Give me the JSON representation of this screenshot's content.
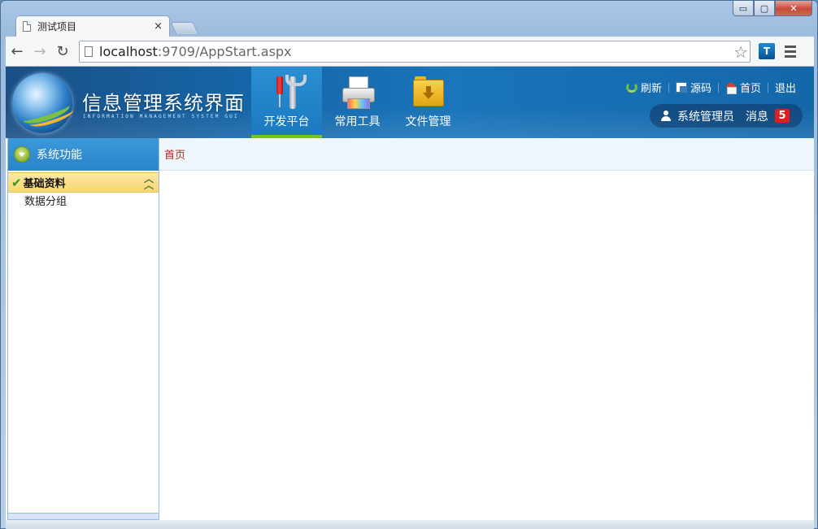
{
  "window": {
    "controls": {
      "minimize": "▭",
      "maximize": "▢",
      "close": "✕"
    }
  },
  "browser": {
    "tab_title": "测试项目",
    "tab_close": "×",
    "url_host": "localhost",
    "url_rest": ":9709/AppStart.aspx",
    "back_icon": "arrow-left-icon",
    "forward_icon": "arrow-right-icon",
    "reload_icon": "reload-icon",
    "ext_label": "T"
  },
  "app": {
    "title": "信息管理系统界面",
    "subtitle": "INFORMATION MANAGEMENT SYSTEM GUI",
    "modules": [
      {
        "label": "开发平台",
        "icon": "tools-icon",
        "active": true
      },
      {
        "label": "常用工具",
        "icon": "printer-icon",
        "active": false
      },
      {
        "label": "文件管理",
        "icon": "folder-download-icon",
        "active": false
      }
    ],
    "links": {
      "refresh": "刷新",
      "source": "源码",
      "home": "首页",
      "logout": "退出"
    },
    "user": {
      "name": "系统管理员",
      "messages_label": "消息",
      "messages_count": "5"
    },
    "colors": {
      "header_blue": "#1566a8",
      "active_underline": "#76c226",
      "badge_red": "#e31d1d"
    }
  },
  "sidebar": {
    "title": "系统功能",
    "groups": [
      {
        "label": "基础资料",
        "items": [
          "数据分组"
        ]
      }
    ]
  },
  "content": {
    "tabs": [
      "首页"
    ]
  }
}
